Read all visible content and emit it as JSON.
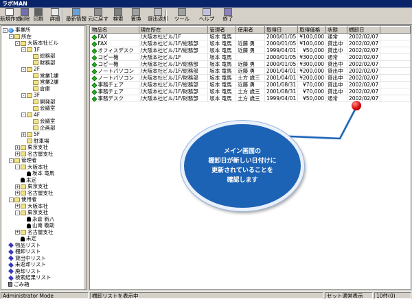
{
  "window": {
    "title": "ラボMAN"
  },
  "toolbar": {
    "buttons": [
      {
        "label": "新規作成",
        "icon": "new-doc-icon"
      },
      {
        "label": "削除",
        "icon": "delete-icon"
      },
      {
        "label": "印刷",
        "icon": "print-icon"
      },
      {
        "label": "詳細",
        "icon": "detail-icon"
      },
      {
        "label": "最新情報",
        "icon": "refresh-icon"
      },
      {
        "label": "元に戻す",
        "icon": "undo-icon"
      },
      {
        "label": "検索",
        "icon": "search-icon"
      },
      {
        "label": "置換",
        "icon": "replace-icon"
      },
      {
        "label": "貸出返却",
        "icon": "lend-return-icon"
      },
      {
        "label": "ツール",
        "icon": "tool-icon"
      },
      {
        "label": "ヘルプ",
        "icon": "help-icon"
      },
      {
        "label": "終了",
        "icon": "exit-icon"
      }
    ]
  },
  "tree": [
    {
      "label": "事業所",
      "level": 0,
      "exp": "-",
      "icon": "globe"
    },
    {
      "label": "所在",
      "level": 1,
      "exp": "-",
      "icon": "fold"
    },
    {
      "label": "大阪本社ビル",
      "level": 2,
      "exp": "-",
      "icon": "fold"
    },
    {
      "label": "1F",
      "level": 3,
      "exp": "-",
      "icon": "fold"
    },
    {
      "label": "総務部",
      "level": 4,
      "exp": "",
      "icon": "fold"
    },
    {
      "label": "財務部",
      "level": 4,
      "exp": "",
      "icon": "fold"
    },
    {
      "label": "2F",
      "level": 3,
      "exp": "-",
      "icon": "fold"
    },
    {
      "label": "営業1課",
      "level": 4,
      "exp": "",
      "icon": "fold"
    },
    {
      "label": "営業2課",
      "level": 4,
      "exp": "",
      "icon": "fold"
    },
    {
      "label": "倉庫",
      "level": 4,
      "exp": "",
      "icon": "fold"
    },
    {
      "label": "3F",
      "level": 3,
      "exp": "-",
      "icon": "fold"
    },
    {
      "label": "開発部",
      "level": 4,
      "exp": "",
      "icon": "fold"
    },
    {
      "label": "会議室",
      "level": 4,
      "exp": "",
      "icon": "fold"
    },
    {
      "label": "4F",
      "level": 3,
      "exp": "-",
      "icon": "fold"
    },
    {
      "label": "会議室",
      "level": 4,
      "exp": "",
      "icon": "fold"
    },
    {
      "label": "企画部",
      "level": 4,
      "exp": "",
      "icon": "fold"
    },
    {
      "label": "5F",
      "level": 3,
      "exp": "+",
      "icon": "fold"
    },
    {
      "label": "駐車場",
      "level": 3,
      "exp": "",
      "icon": "fold"
    },
    {
      "label": "東京支社",
      "level": 2,
      "exp": "+",
      "icon": "fold"
    },
    {
      "label": "名古屋支社",
      "level": 2,
      "exp": "+",
      "icon": "fold"
    },
    {
      "label": "管理者",
      "level": 1,
      "exp": "-",
      "icon": "fold"
    },
    {
      "label": "大阪本社",
      "level": 2,
      "exp": "-",
      "icon": "fold"
    },
    {
      "label": "坂本 竜馬",
      "level": 3,
      "exp": "",
      "icon": "person"
    },
    {
      "label": "未定",
      "level": 2,
      "exp": "",
      "icon": "person"
    },
    {
      "label": "東京支社",
      "level": 2,
      "exp": "+",
      "icon": "fold"
    },
    {
      "label": "名古屋支社",
      "level": 2,
      "exp": "+",
      "icon": "fold"
    },
    {
      "label": "使用者",
      "level": 1,
      "exp": "-",
      "icon": "fold"
    },
    {
      "label": "大阪本社",
      "level": 2,
      "exp": "+",
      "icon": "fold"
    },
    {
      "label": "東京支社",
      "level": 2,
      "exp": "-",
      "icon": "fold"
    },
    {
      "label": "永倉 新八",
      "level": 3,
      "exp": "",
      "icon": "person"
    },
    {
      "label": "山南 敬助",
      "level": 3,
      "exp": "",
      "icon": "person"
    },
    {
      "label": "名古屋支社",
      "level": 2,
      "exp": "+",
      "icon": "fold"
    },
    {
      "label": "未定",
      "level": 2,
      "exp": "",
      "icon": "person"
    },
    {
      "label": "物品リスト",
      "level": 0,
      "exp": "",
      "icon": "diamond"
    },
    {
      "label": "棚卸リスト",
      "level": 0,
      "exp": "",
      "icon": "diamond"
    },
    {
      "label": "貸出中リスト",
      "level": 0,
      "exp": "",
      "icon": "diamond"
    },
    {
      "label": "未返却リスト",
      "level": 0,
      "exp": "",
      "icon": "diamond"
    },
    {
      "label": "廃却リスト",
      "level": 0,
      "exp": "",
      "icon": "diamond"
    },
    {
      "label": "検索結果リスト",
      "level": 0,
      "exp": "",
      "icon": "diamond"
    },
    {
      "label": "ごみ箱",
      "level": 0,
      "exp": "",
      "icon": "trash"
    }
  ],
  "table": {
    "columns": [
      "物品名",
      "現在所在",
      "管理者",
      "使用者",
      "取得日",
      "取得価格",
      "状態",
      "棚卸日"
    ],
    "rows": [
      [
        "FAX",
        "/大阪本社ビル/1F",
        "坂本 竜馬",
        "",
        "2000/01/05",
        "¥100,000",
        "通常",
        "2002/02/07"
      ],
      [
        "FAX",
        "/大阪本社ビル/1F/総務部",
        "坂本 竜馬",
        "近藤 勇",
        "2000/01/05",
        "¥100,000",
        "貸出中",
        "2002/02/07"
      ],
      [
        "オフィスデスク",
        "/大阪本社ビル/1F/総務部",
        "坂本 竜馬",
        "近藤 勇",
        "1999/04/01",
        "¥50,000",
        "貸出中",
        "2002/02/07"
      ],
      [
        "コピー機",
        "/大阪本社ビル/1F",
        "坂本 竜馬",
        "",
        "2000/01/05",
        "¥300,000",
        "通常",
        "2002/02/07"
      ],
      [
        "コピー機",
        "/大阪本社ビル/1F/総務部",
        "坂本 竜馬",
        "近藤 勇",
        "2000/01/05",
        "¥300,000",
        "貸出中",
        "2002/02/07"
      ],
      [
        "ノートパソコン",
        "/大阪本社ビル/1F/総務部",
        "坂本 竜馬",
        "近藤 勇",
        "2001/04/01",
        "¥200,000",
        "貸出中",
        "2002/02/07"
      ],
      [
        "ノートパソコン",
        "/大阪本社ビル/1F/財務部",
        "坂本 竜馬",
        "土方 歳三",
        "2001/04/01",
        "¥200,000",
        "貸出中",
        "2002/02/07"
      ],
      [
        "事務チェア",
        "/大阪本社ビル/1F/総務部",
        "坂本 竜馬",
        "近藤 勇",
        "2001/08/31",
        "¥70,000",
        "貸出中",
        "2002/02/07"
      ],
      [
        "事務チェア",
        "/大阪本社ビル/1F/財務部",
        "坂本 竜馬",
        "土方 歳三",
        "2001/08/31",
        "¥70,000",
        "貸出中",
        "2002/02/07"
      ],
      [
        "事務デスク",
        "/大阪本社ビル/1F/財務部",
        "坂本 竜馬",
        "土方 歳三",
        "1999/04/01",
        "¥50,000",
        "通常",
        "2002/02/07"
      ]
    ]
  },
  "callout": {
    "text": "メイン画面の\n棚卸日が新しい日付けに\n更新されていることを\n確認します"
  },
  "status": {
    "mode": "Administrator Mode",
    "message": "棚卸リストを表示中",
    "display": "セット適常表示",
    "count": "10件(0)"
  },
  "colors": {
    "title_bar": "#0a246a",
    "callout": "#1d63b5",
    "dot": "#d40000",
    "item_gem": "#22b022"
  }
}
